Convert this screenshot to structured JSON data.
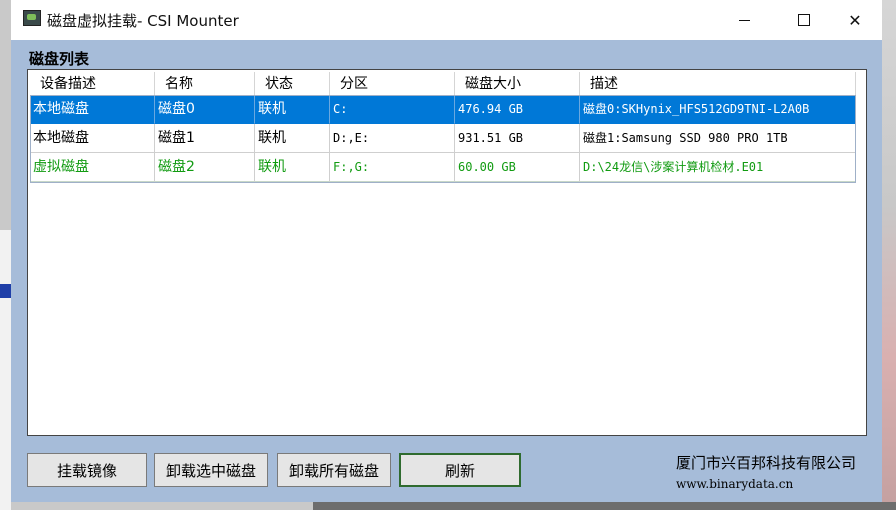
{
  "window": {
    "title": "磁盘虚拟挂载- CSI Mounter"
  },
  "section": {
    "label": "磁盘列表"
  },
  "table": {
    "headers": [
      "设备描述",
      "名称",
      "状态",
      "分区",
      "磁盘大小",
      "描述"
    ],
    "rows": [
      {
        "device": "本地磁盘",
        "name": "磁盘0",
        "status": "联机",
        "partition": "C:",
        "size": "476.94 GB",
        "desc": "磁盘0:SKHynix_HFS512GD9TNI-L2A0B",
        "selected": true
      },
      {
        "device": "本地磁盘",
        "name": "磁盘1",
        "status": "联机",
        "partition": "D:,E:",
        "size": "931.51 GB",
        "desc": "磁盘1:Samsung SSD 980 PRO 1TB",
        "selected": false
      },
      {
        "device": "虚拟磁盘",
        "name": "磁盘2",
        "status": "联机",
        "partition": "F:,G:",
        "size": "60.00 GB",
        "desc": "D:\\24龙信\\涉案计算机检材.E01",
        "selected": false
      }
    ]
  },
  "buttons": {
    "mount": "挂载镜像",
    "unmount_selected": "卸载选中磁盘",
    "unmount_all": "卸载所有磁盘",
    "refresh": "刷新"
  },
  "footer": {
    "company": "厦门市兴百邦科技有限公司",
    "website": "www.binarydata.cn"
  },
  "colors": {
    "selection": "#0078d7",
    "virtual_row": "#119b11",
    "window_bg": "#a6bcd9"
  }
}
